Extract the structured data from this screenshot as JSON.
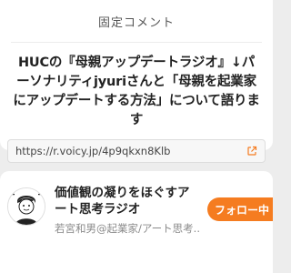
{
  "pinned_comment": {
    "header": "固定コメント",
    "text": "HUCの『母親アップデートラジオ』↓パーソナリティjyuriさんと「母親を起業家にアップデートする方法」について語ります",
    "link_url": "https://r.voicy.jp/4p9qkxn8Klb",
    "link_icon": "external-link-icon"
  },
  "channel": {
    "title": "価値観の凝りをほぐすアート思考ラジオ",
    "owner": "若宮和男@起業家/アート思考...",
    "follow_label": "フォロー中",
    "avatar_icon": "person-avatar-illustration"
  },
  "colors": {
    "accent": "#f57c20",
    "background": "#ededed",
    "card": "#ffffff"
  }
}
